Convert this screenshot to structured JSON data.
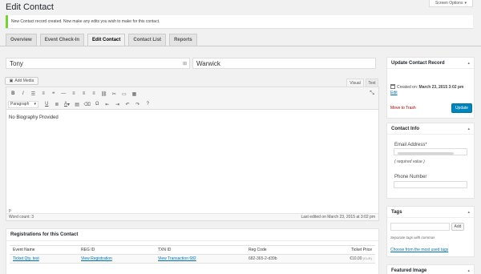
{
  "header": {
    "title": "Edit Contact",
    "screen_options": "Screen Options",
    "notice": "New Contact record created. Now make any edits you wish to make for this contact."
  },
  "tabs": [
    {
      "label": "Overview"
    },
    {
      "label": "Event Check-In"
    },
    {
      "label": "Edit Contact",
      "active": true
    },
    {
      "label": "Contact List"
    },
    {
      "label": "Reports"
    }
  ],
  "contact": {
    "first_name": "Tony",
    "last_name": "Warwick"
  },
  "editor": {
    "add_media": "Add Media",
    "visual_tab": "Visual",
    "text_tab": "Text",
    "format_select": "Paragraph",
    "toolbar_icons": [
      "bold-icon",
      "italic-icon",
      "bulleted-list-icon",
      "numbered-list-icon",
      "blockquote-icon",
      "horizontal-rule-icon",
      "align-left-icon",
      "align-center-icon",
      "align-right-icon",
      "link-icon",
      "unlink-icon",
      "read-more-icon",
      "toolbar-toggle-icon"
    ],
    "toolbar_icons_row2": [
      "underline-icon",
      "justify-icon",
      "text-color-icon",
      "paste-as-text-icon",
      "clear-formatting-icon",
      "special-character-icon",
      "outdent-icon",
      "indent-icon",
      "undo-icon",
      "redo-icon",
      "help-icon"
    ],
    "content": "No Biography Provided",
    "path": "p",
    "word_count": "Word count: 3",
    "last_edited": "Last edited on March 23, 2015 at 3:02 pm"
  },
  "registrations": {
    "title": "Registrations for this Contact",
    "columns": [
      "Event Name",
      "REG ID",
      "TXN ID",
      "Reg Code",
      "Ticket Price"
    ],
    "rows": [
      {
        "event_name": "Ticket Qty. test",
        "reg_id": "View Registration",
        "txn_id": "View Transaction 682",
        "reg_code": "682-365-2-d39b",
        "ticket_price": "€10.00",
        "price_tag": "(EUR)"
      }
    ]
  },
  "sidebar": {
    "update_box": {
      "title": "Update Contact Record",
      "created_label": "Created on:",
      "created_date": "March 23, 2015 3:02 pm",
      "edit_link": "Edit",
      "trash_link": "Move to Trash",
      "update_button": "Update"
    },
    "contact_info": {
      "title": "Contact Info",
      "email_label": "Email Address*",
      "required_note": "( required value )",
      "phone_label": "Phone Number"
    },
    "tags": {
      "title": "Tags",
      "add_button": "Add",
      "hint": "Separate tags with commas",
      "most_used": "Choose from the most used tags"
    },
    "featured_image": {
      "title": "Featured Image"
    }
  },
  "colors": {
    "accent": "#0073aa",
    "primary_button": "#0085ba",
    "notice": "#7ad03a",
    "trash": "#aa0000"
  }
}
